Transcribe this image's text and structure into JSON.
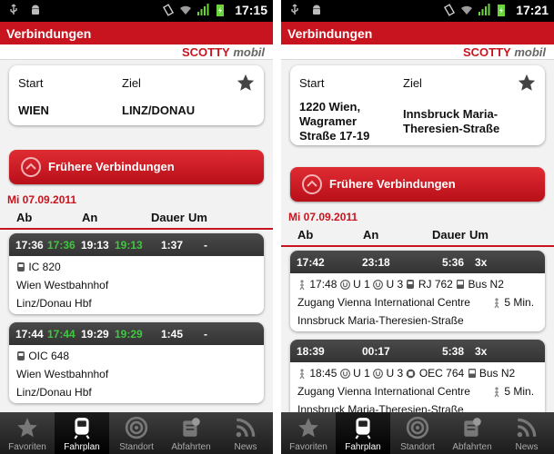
{
  "colors": {
    "brand_red": "#c8141e",
    "green_time": "#3ec83e",
    "header_dark": "#3d3d3d"
  },
  "left": {
    "status": {
      "time": "17:15"
    },
    "title": "Verbindungen",
    "brand": {
      "main": "SCOTTY",
      "sub": "mobil"
    },
    "search": {
      "start_label": "Start",
      "ziel_label": "Ziel",
      "start_value": "WIEN",
      "ziel_value": "LINZ/DONAU"
    },
    "earlier_button": "Frühere Verbindungen",
    "date": "Mi 07.09.2011",
    "headers": {
      "ab": "Ab",
      "an": "An",
      "dauer": "Dauer",
      "um": "Um"
    },
    "connections": [
      {
        "dep": "17:36",
        "dep_rt": "17:36",
        "arr": "19:13",
        "arr_rt": "19:13",
        "duration": "1:37",
        "changes": "-",
        "train": "IC 820",
        "from": "Wien Westbahnhof",
        "to": "Linz/Donau Hbf"
      },
      {
        "dep": "17:44",
        "dep_rt": "17:44",
        "arr": "19:29",
        "arr_rt": "19:29",
        "duration": "1:45",
        "changes": "-",
        "train": "OIC 648",
        "from": "Wien Westbahnhof",
        "to": "Linz/Donau Hbf"
      }
    ],
    "nav": [
      "Favoriten",
      "Fahrplan",
      "Standort",
      "Abfahrten",
      "News"
    ]
  },
  "right": {
    "status": {
      "time": "17:21"
    },
    "title": "Verbindungen",
    "brand": {
      "main": "SCOTTY",
      "sub": "mobil"
    },
    "search": {
      "start_label": "Start",
      "ziel_label": "Ziel",
      "start_value": [
        "1220 Wien,",
        "Wagramer",
        "Straße 17-19"
      ],
      "ziel_value": [
        "Innsbruck Maria-",
        "Theresien-Straße"
      ]
    },
    "earlier_button": "Frühere Verbindungen",
    "date": "Mi 07.09.2011",
    "headers": {
      "ab": "Ab",
      "an": "An",
      "dauer": "Dauer",
      "um": "Um"
    },
    "connections": [
      {
        "dep": "17:42",
        "arr": "23:18",
        "duration": "5:36",
        "changes": "3x",
        "walk_time": "17:48",
        "u1": "U 1",
        "u3": "U 3",
        "train": "RJ 762",
        "bus": "Bus N2",
        "zugang": "Zugang Vienna International Centre",
        "walk": "5 Min.",
        "to": "Innsbruck Maria-Theresien-Straße"
      },
      {
        "dep": "18:39",
        "arr": "00:17",
        "duration": "5:38",
        "changes": "3x",
        "walk_time": "18:45",
        "u1": "U 1",
        "u3": "U 3",
        "train": "OEC 764",
        "bus": "Bus N2",
        "zugang": "Zugang Vienna International Centre",
        "walk": "5 Min.",
        "to": "Innsbruck Maria-Theresien-Straße"
      }
    ],
    "nav": [
      "Favoriten",
      "Fahrplan",
      "Standort",
      "Abfahrten",
      "News"
    ]
  }
}
